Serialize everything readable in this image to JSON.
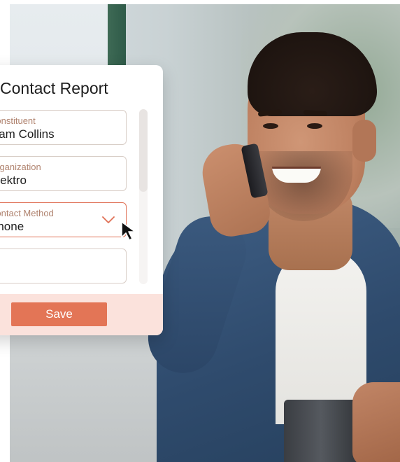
{
  "card": {
    "title": "Contact Report",
    "fields": [
      {
        "label": "Constituent",
        "value": "Liam Collins",
        "type": "text"
      },
      {
        "label": "Organization",
        "value": "Elektro",
        "type": "text"
      },
      {
        "label": "Contact Method",
        "value": "Phone",
        "type": "select",
        "active": true
      },
      {
        "label": "",
        "value": "",
        "type": "text"
      }
    ],
    "save_label": "Save"
  },
  "icons": {
    "dropdown": "chevron-down-icon",
    "pointer": "mouse-pointer-icon"
  },
  "colors": {
    "accent": "#e37556",
    "footer": "#fbe2dc",
    "label": "#b0836f",
    "border": "#d9cec7"
  }
}
